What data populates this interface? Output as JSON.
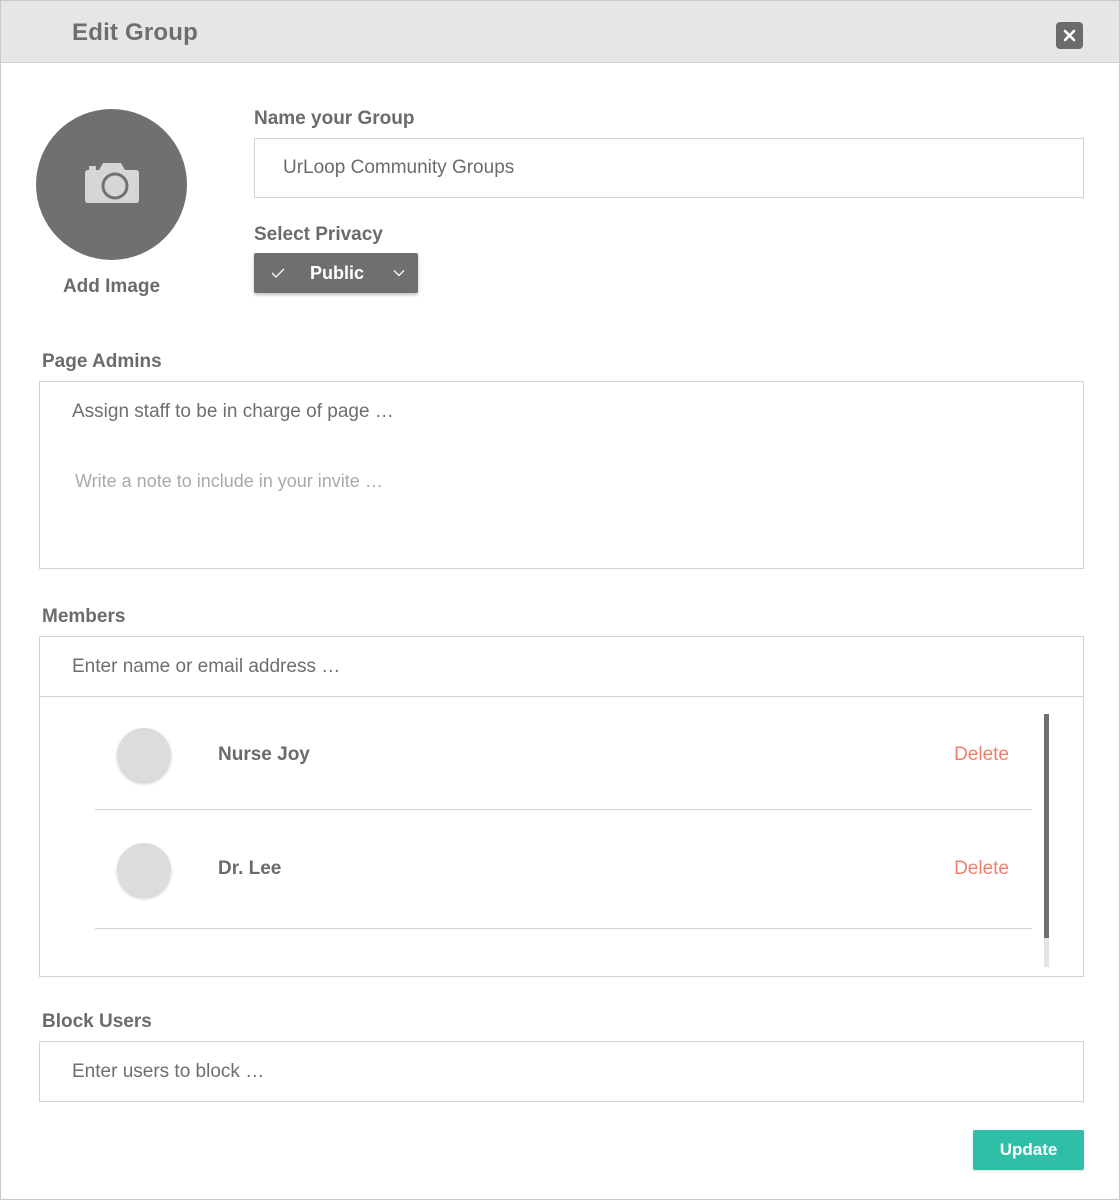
{
  "header": {
    "title": "Edit Group",
    "close_icon": "close-icon"
  },
  "image_upload": {
    "label": "Add Image",
    "icon": "camera-icon"
  },
  "group_name": {
    "label": "Name your Group",
    "value": "UrLoop Community Groups"
  },
  "privacy": {
    "label": "Select Privacy",
    "selected": "Public",
    "icon": "check-icon"
  },
  "page_admins": {
    "label": "Page Admins",
    "assign_placeholder": "Assign staff to be in charge of page …",
    "note_placeholder": "Write a note to include in your invite …"
  },
  "members": {
    "label": "Members",
    "search_placeholder": "Enter name or email address …",
    "items": [
      {
        "name": "Nurse Joy",
        "delete_label": "Delete"
      },
      {
        "name": "Dr. Lee",
        "delete_label": "Delete"
      }
    ]
  },
  "block_users": {
    "label": "Block Users",
    "placeholder": "Enter users to block …"
  },
  "footer": {
    "update_label": "Update"
  },
  "colors": {
    "accent": "#2fbfa6",
    "delete": "#f07f6f",
    "header_bg": "#e6e6e6",
    "dark": "#6b6b6b"
  }
}
